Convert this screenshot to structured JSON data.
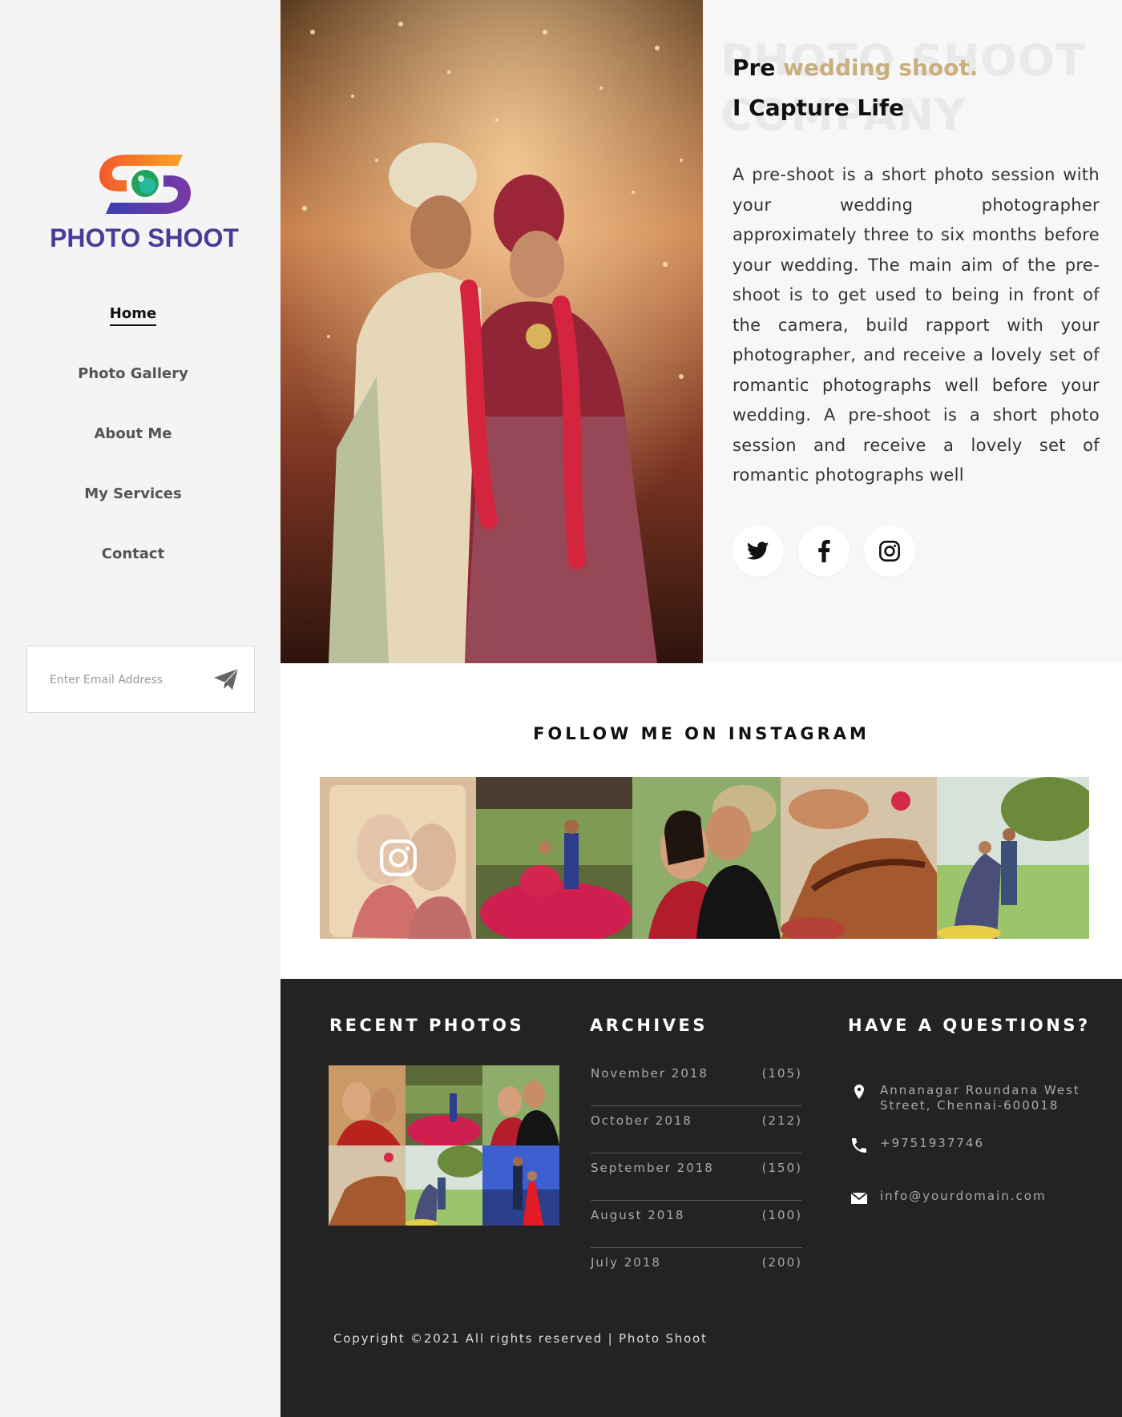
{
  "brand": {
    "name": "PHOTO SHOOT"
  },
  "nav": {
    "items": [
      {
        "label": "Home",
        "active": true
      },
      {
        "label": "Photo Gallery"
      },
      {
        "label": "About Me"
      },
      {
        "label": "My Services"
      },
      {
        "label": "Contact"
      }
    ]
  },
  "subscribe": {
    "placeholder": "Enter Email Address",
    "icon": "paper-plane-icon"
  },
  "hero": {
    "watermark_line1": "PHOTO SHOOT",
    "watermark_line2": "COMPANY",
    "headline_prefix": "Pre ",
    "headline_accent": "wedding shoot.",
    "headline_line2": "I Capture Life",
    "paragraph": "A pre-shoot is a short photo session with your wedding photographer approximately three to six months before your wedding. The main aim of the pre-shoot is to get used to being in front of the camera, build rapport with your photographer, and receive a lovely set of romantic photographs well before your wedding. A pre-shoot is a short photo session and receive a lovely set of romantic photographs well",
    "socials": [
      "twitter-icon",
      "facebook-icon",
      "instagram-icon"
    ]
  },
  "instagram": {
    "title": "FOLLOW ME ON INSTAGRAM"
  },
  "footer": {
    "recent_title": "RECENT PHOTOS",
    "archives_title": "ARCHIVES",
    "archives": [
      {
        "month": "November 2018",
        "count": "(105)"
      },
      {
        "month": "October 2018",
        "count": "(212)"
      },
      {
        "month": "September 2018",
        "count": "(150)"
      },
      {
        "month": "August 2018",
        "count": "(100)"
      },
      {
        "month": "July 2018",
        "count": "(200)"
      }
    ],
    "contact_title": "HAVE A QUESTIONS?",
    "address": "Annanagar Roundana West Street, Chennai-600018",
    "phone": "+9751937746",
    "email": "info@yourdomain.com",
    "copyright": "Copyright ©2021 All rights reserved | Photo Shoot"
  },
  "colors": {
    "accent": "#c9ae7f",
    "brand": "#4b3a9a",
    "footer_bg": "#232323",
    "sidebar_bg": "#f4f4f4"
  }
}
